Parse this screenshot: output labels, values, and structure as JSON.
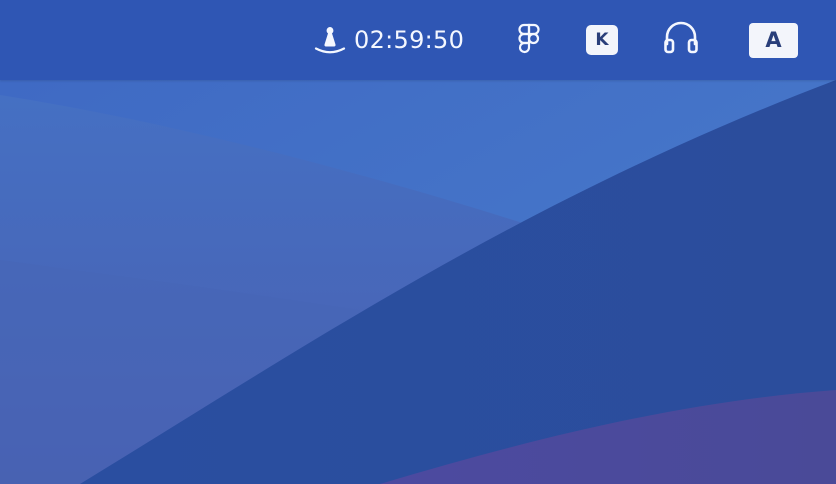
{
  "menubar": {
    "timer": {
      "icon": "metronome-icon",
      "time": "02:59:50"
    },
    "figma": {
      "icon": "figma-icon"
    },
    "keycastr": {
      "label": "K"
    },
    "headphones": {
      "icon": "headphones-icon"
    },
    "input_source": {
      "label": "A"
    }
  },
  "colors": {
    "menubar_bg": "#2f56b4",
    "wallpaper_light": "#4478c9",
    "wallpaper_dark": "#26489a",
    "wallpaper_purple": "#4a4a9c"
  }
}
